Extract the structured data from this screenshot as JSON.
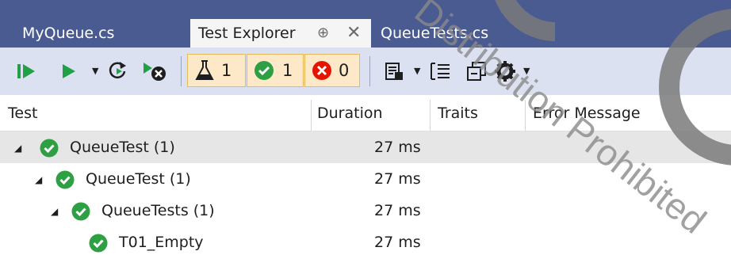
{
  "tabs": [
    {
      "label": "MyQueue.cs",
      "active": false
    },
    {
      "label": "Test Explorer",
      "active": true,
      "pin_glyph": "⊕",
      "close_glyph": "✕"
    },
    {
      "label": "QueueTests.cs",
      "active": false
    }
  ],
  "toolbar": {
    "icons": [
      "run-all-icon",
      "run-icon",
      "run-dropdown-arrow",
      "repeat-last-run-icon",
      "cancel-run-icon",
      "flask-icon",
      "passed-icon",
      "failed-icon",
      "playlist-icon",
      "group-by-icon",
      "collapse-icon",
      "settings-icon"
    ],
    "total_count": "1",
    "passed_count": "1",
    "failed_count": "0"
  },
  "columns": {
    "test": "Test",
    "duration": "Duration",
    "traits": "Traits",
    "error_message": "Error Message"
  },
  "rows": [
    {
      "label": "QueueTest (1)",
      "duration": "27 ms",
      "level": 0,
      "expanded": true
    },
    {
      "label": "QueueTest (1)",
      "duration": "27 ms",
      "level": 1,
      "expanded": true
    },
    {
      "label": "QueueTests (1)",
      "duration": "27 ms",
      "level": 2,
      "expanded": true
    },
    {
      "label": "T01_Empty",
      "duration": "27 ms",
      "level": 3,
      "expanded": false
    }
  ],
  "colors": {
    "tab_bar": "#4a5b92",
    "toolbar": "#dbe1f1",
    "pass_green": "#2ea043",
    "fail_red": "#e51400",
    "run_green": "#22a045",
    "counter_bg": "#fde9c8"
  },
  "watermark_text": "Distribution Prohibited"
}
